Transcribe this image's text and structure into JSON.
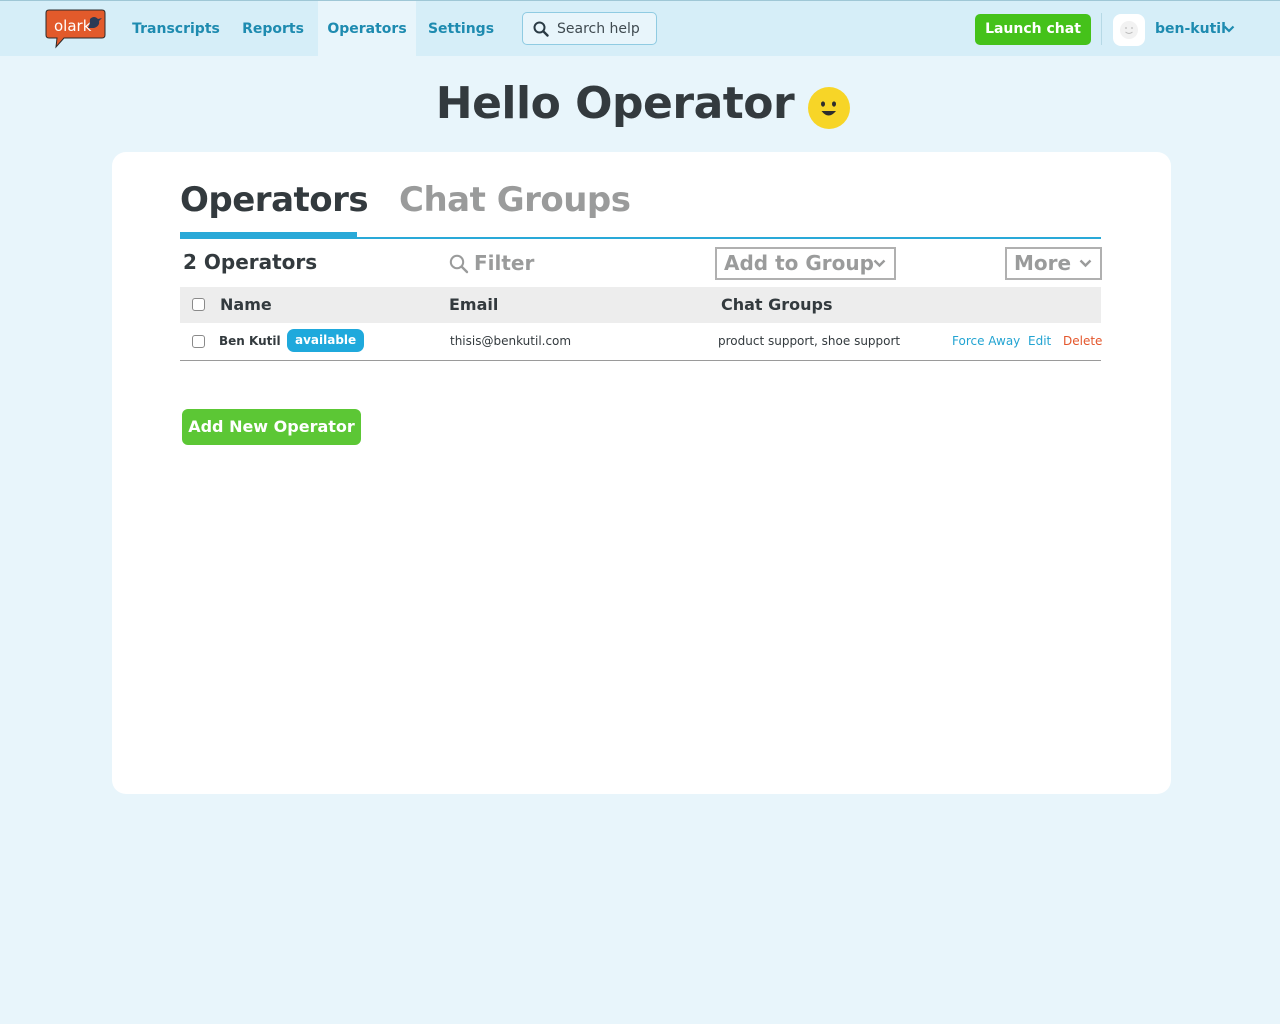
{
  "nav": {
    "logo_text": "olark",
    "items": [
      {
        "label": "Transcripts",
        "active": false
      },
      {
        "label": "Reports",
        "active": false
      },
      {
        "label": "Operators",
        "active": true
      },
      {
        "label": "Settings",
        "active": false
      }
    ],
    "search_placeholder": "Search help",
    "launch_label": "Launch chat",
    "username": "ben-kutil"
  },
  "page": {
    "greeting": "Hello Operator"
  },
  "tabs": [
    {
      "label": "Operators",
      "active": true
    },
    {
      "label": "Chat Groups",
      "active": false
    }
  ],
  "toolbar": {
    "count_label": "2 Operators",
    "filter_placeholder": "Filter",
    "add_to_group_label": "Add to Group",
    "more_label": "More"
  },
  "table": {
    "headers": [
      "Name",
      "Email",
      "Chat Groups"
    ],
    "rows": [
      {
        "name": "Ben Kutil",
        "status": "available",
        "email": "thisis@benkutil.com",
        "groups": "product support, shoe support",
        "actions": [
          "Force Away",
          "Edit",
          "Delete"
        ]
      }
    ]
  },
  "add_operator_label": "Add New Operator",
  "colors": {
    "accent": "#1e8bb0",
    "launch_green": "#45c21a",
    "add_green": "#5cc735",
    "badge_blue": "#1fa9dc",
    "delete_red": "#e4562b",
    "page_bg": "#e8f5fb"
  }
}
